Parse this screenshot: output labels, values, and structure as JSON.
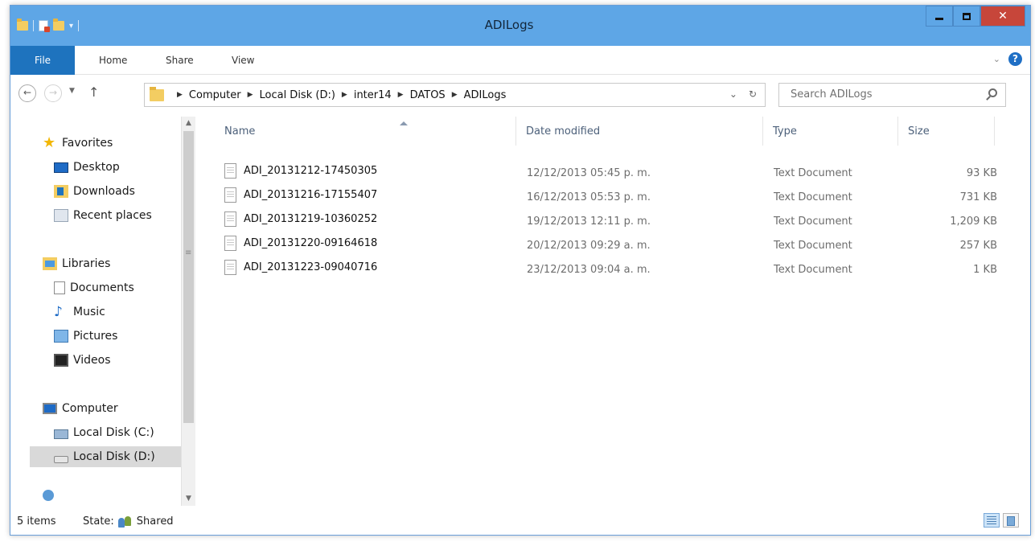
{
  "window": {
    "title": "ADILogs"
  },
  "ribbon": {
    "tabs": [
      "File",
      "Home",
      "Share",
      "View"
    ]
  },
  "address": {
    "crumbs": [
      "Computer",
      "Local Disk (D:)",
      "inter14",
      "DATOS",
      "ADILogs"
    ],
    "search_placeholder": "Search ADILogs"
  },
  "navigation": {
    "favorites": "Favorites",
    "favorite_items": [
      "Desktop",
      "Downloads",
      "Recent places"
    ],
    "libraries": "Libraries",
    "library_items": [
      "Documents",
      "Music",
      "Pictures",
      "Videos"
    ],
    "computer": "Computer",
    "computer_items": [
      "Local Disk (C:)",
      "Local Disk (D:)"
    ]
  },
  "columns": [
    "Name",
    "Date modified",
    "Type",
    "Size"
  ],
  "files": [
    {
      "name": "ADI_20131212-17450305",
      "date": "12/12/2013 05:45 p. m.",
      "type": "Text Document",
      "size": "93 KB"
    },
    {
      "name": "ADI_20131216-17155407",
      "date": "16/12/2013 05:53 p. m.",
      "type": "Text Document",
      "size": "731 KB"
    },
    {
      "name": "ADI_20131219-10360252",
      "date": "19/12/2013 12:11 p. m.",
      "type": "Text Document",
      "size": "1,209 KB"
    },
    {
      "name": "ADI_20131220-09164618",
      "date": "20/12/2013 09:29 a. m.",
      "type": "Text Document",
      "size": "257 KB"
    },
    {
      "name": "ADI_20131223-09040716",
      "date": "23/12/2013 09:04 a. m.",
      "type": "Text Document",
      "size": "1 KB"
    }
  ],
  "status": {
    "items": "5 items",
    "state_label": "State:",
    "state_value": "Shared"
  }
}
